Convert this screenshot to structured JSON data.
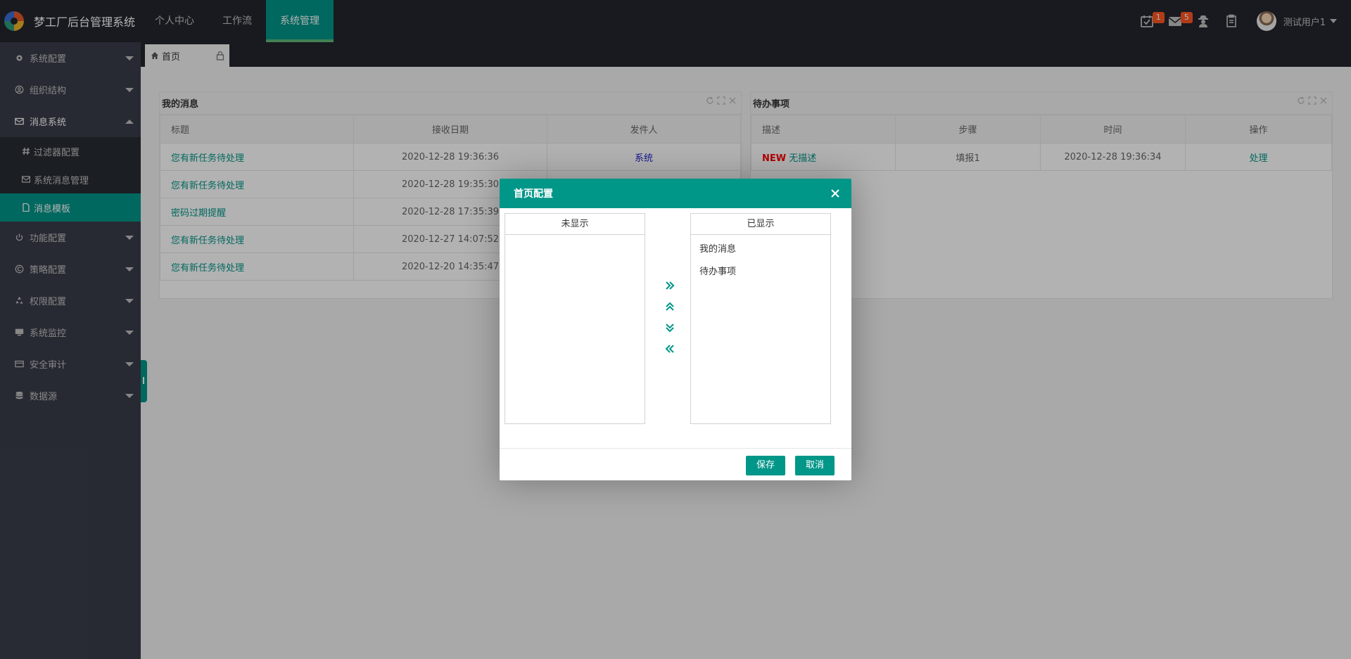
{
  "app": {
    "title": "梦工厂后台管理系统"
  },
  "topnav": [
    {
      "label": "个人中心"
    },
    {
      "label": "工作流"
    },
    {
      "label": "系统管理"
    }
  ],
  "topbar": {
    "calendar_badge": "1",
    "mail_badge": "5",
    "username": "测试用户1"
  },
  "sidebar": {
    "items": [
      {
        "label": "系统配置"
      },
      {
        "label": "组织结构"
      },
      {
        "label": "消息系统"
      },
      {
        "label": "功能配置"
      },
      {
        "label": "策略配置"
      },
      {
        "label": "权限配置"
      },
      {
        "label": "系统监控"
      },
      {
        "label": "安全审计"
      },
      {
        "label": "数据源"
      }
    ],
    "subitems": [
      {
        "label": "过滤器配置"
      },
      {
        "label": "系统消息管理"
      },
      {
        "label": "消息模板"
      }
    ]
  },
  "tabs": [
    {
      "label": "首页"
    }
  ],
  "messages_panel": {
    "title": "我的消息",
    "columns": [
      "标题",
      "接收日期",
      "发件人"
    ],
    "rows": [
      {
        "title": "您有新任务待处理",
        "date": "2020-12-28 19:36:36",
        "sender": "系统"
      },
      {
        "title": "您有新任务待处理",
        "date": "2020-12-28 19:35:30",
        "sender": ""
      },
      {
        "title": "密码过期提醒",
        "date": "2020-12-28 17:35:39",
        "sender": ""
      },
      {
        "title": "您有新任务待处理",
        "date": "2020-12-27 14:07:52",
        "sender": ""
      },
      {
        "title": "您有新任务待处理",
        "date": "2020-12-20 14:35:47",
        "sender": ""
      }
    ]
  },
  "todo_panel": {
    "title": "待办事项",
    "columns": [
      "描述",
      "步骤",
      "时间",
      "操作"
    ],
    "rows": [
      {
        "new_tag": "NEW",
        "desc": "无描述",
        "step": "填报1",
        "time": "2020-12-28 19:36:34",
        "action": "处理"
      }
    ]
  },
  "dialog": {
    "title": "首页配置",
    "left_title": "未显示",
    "right_title": "已显示",
    "left_items": [],
    "right_items": [
      "我的消息",
      "待办事项"
    ],
    "save_label": "保存",
    "cancel_label": "取消"
  },
  "colors": {
    "accent": "#009688",
    "topbar": "#23262e",
    "sidebar": "#393d49",
    "badge": "#ff5722"
  }
}
